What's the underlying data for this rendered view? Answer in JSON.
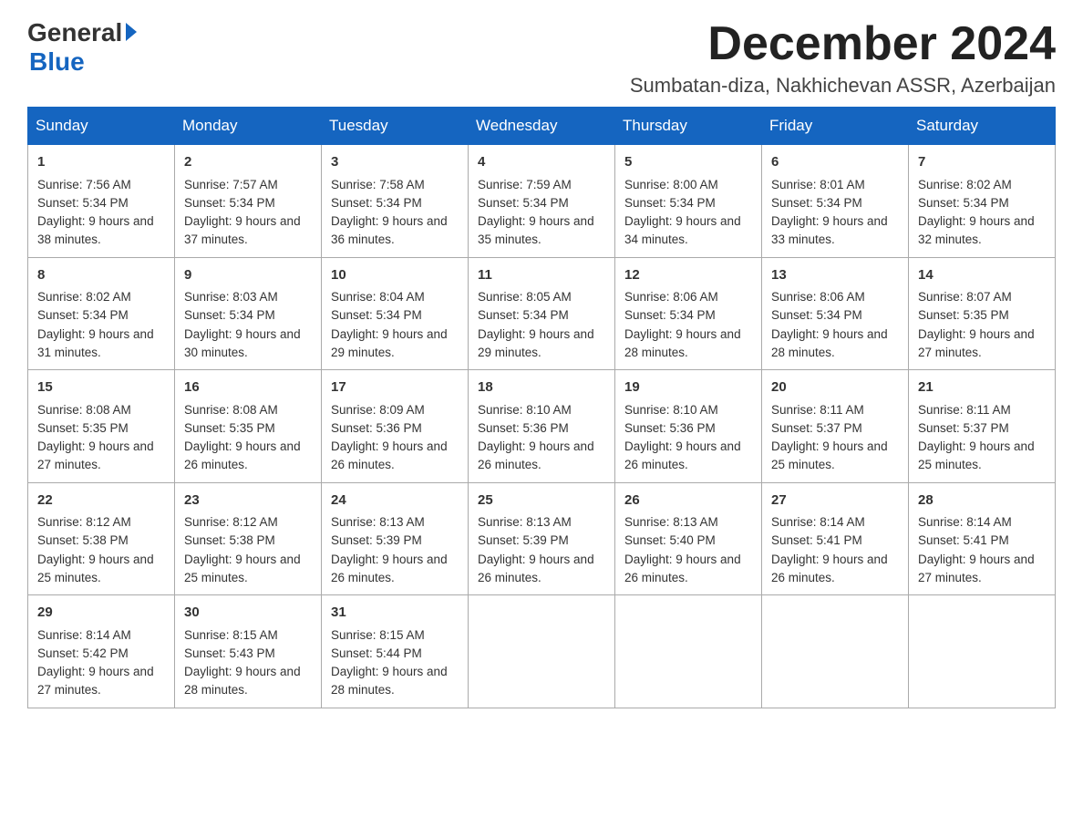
{
  "logo": {
    "general": "General",
    "blue": "Blue"
  },
  "header": {
    "month_title": "December 2024",
    "subtitle": "Sumbatan-diza, Nakhichevan ASSR, Azerbaijan"
  },
  "days_of_week": [
    "Sunday",
    "Monday",
    "Tuesday",
    "Wednesday",
    "Thursday",
    "Friday",
    "Saturday"
  ],
  "weeks": [
    [
      {
        "day": "1",
        "sunrise": "7:56 AM",
        "sunset": "5:34 PM",
        "daylight": "9 hours and 38 minutes."
      },
      {
        "day": "2",
        "sunrise": "7:57 AM",
        "sunset": "5:34 PM",
        "daylight": "9 hours and 37 minutes."
      },
      {
        "day": "3",
        "sunrise": "7:58 AM",
        "sunset": "5:34 PM",
        "daylight": "9 hours and 36 minutes."
      },
      {
        "day": "4",
        "sunrise": "7:59 AM",
        "sunset": "5:34 PM",
        "daylight": "9 hours and 35 minutes."
      },
      {
        "day": "5",
        "sunrise": "8:00 AM",
        "sunset": "5:34 PM",
        "daylight": "9 hours and 34 minutes."
      },
      {
        "day": "6",
        "sunrise": "8:01 AM",
        "sunset": "5:34 PM",
        "daylight": "9 hours and 33 minutes."
      },
      {
        "day": "7",
        "sunrise": "8:02 AM",
        "sunset": "5:34 PM",
        "daylight": "9 hours and 32 minutes."
      }
    ],
    [
      {
        "day": "8",
        "sunrise": "8:02 AM",
        "sunset": "5:34 PM",
        "daylight": "9 hours and 31 minutes."
      },
      {
        "day": "9",
        "sunrise": "8:03 AM",
        "sunset": "5:34 PM",
        "daylight": "9 hours and 30 minutes."
      },
      {
        "day": "10",
        "sunrise": "8:04 AM",
        "sunset": "5:34 PM",
        "daylight": "9 hours and 29 minutes."
      },
      {
        "day": "11",
        "sunrise": "8:05 AM",
        "sunset": "5:34 PM",
        "daylight": "9 hours and 29 minutes."
      },
      {
        "day": "12",
        "sunrise": "8:06 AM",
        "sunset": "5:34 PM",
        "daylight": "9 hours and 28 minutes."
      },
      {
        "day": "13",
        "sunrise": "8:06 AM",
        "sunset": "5:34 PM",
        "daylight": "9 hours and 28 minutes."
      },
      {
        "day": "14",
        "sunrise": "8:07 AM",
        "sunset": "5:35 PM",
        "daylight": "9 hours and 27 minutes."
      }
    ],
    [
      {
        "day": "15",
        "sunrise": "8:08 AM",
        "sunset": "5:35 PM",
        "daylight": "9 hours and 27 minutes."
      },
      {
        "day": "16",
        "sunrise": "8:08 AM",
        "sunset": "5:35 PM",
        "daylight": "9 hours and 26 minutes."
      },
      {
        "day": "17",
        "sunrise": "8:09 AM",
        "sunset": "5:36 PM",
        "daylight": "9 hours and 26 minutes."
      },
      {
        "day": "18",
        "sunrise": "8:10 AM",
        "sunset": "5:36 PM",
        "daylight": "9 hours and 26 minutes."
      },
      {
        "day": "19",
        "sunrise": "8:10 AM",
        "sunset": "5:36 PM",
        "daylight": "9 hours and 26 minutes."
      },
      {
        "day": "20",
        "sunrise": "8:11 AM",
        "sunset": "5:37 PM",
        "daylight": "9 hours and 25 minutes."
      },
      {
        "day": "21",
        "sunrise": "8:11 AM",
        "sunset": "5:37 PM",
        "daylight": "9 hours and 25 minutes."
      }
    ],
    [
      {
        "day": "22",
        "sunrise": "8:12 AM",
        "sunset": "5:38 PM",
        "daylight": "9 hours and 25 minutes."
      },
      {
        "day": "23",
        "sunrise": "8:12 AM",
        "sunset": "5:38 PM",
        "daylight": "9 hours and 25 minutes."
      },
      {
        "day": "24",
        "sunrise": "8:13 AM",
        "sunset": "5:39 PM",
        "daylight": "9 hours and 26 minutes."
      },
      {
        "day": "25",
        "sunrise": "8:13 AM",
        "sunset": "5:39 PM",
        "daylight": "9 hours and 26 minutes."
      },
      {
        "day": "26",
        "sunrise": "8:13 AM",
        "sunset": "5:40 PM",
        "daylight": "9 hours and 26 minutes."
      },
      {
        "day": "27",
        "sunrise": "8:14 AM",
        "sunset": "5:41 PM",
        "daylight": "9 hours and 26 minutes."
      },
      {
        "day": "28",
        "sunrise": "8:14 AM",
        "sunset": "5:41 PM",
        "daylight": "9 hours and 27 minutes."
      }
    ],
    [
      {
        "day": "29",
        "sunrise": "8:14 AM",
        "sunset": "5:42 PM",
        "daylight": "9 hours and 27 minutes."
      },
      {
        "day": "30",
        "sunrise": "8:15 AM",
        "sunset": "5:43 PM",
        "daylight": "9 hours and 28 minutes."
      },
      {
        "day": "31",
        "sunrise": "8:15 AM",
        "sunset": "5:44 PM",
        "daylight": "9 hours and 28 minutes."
      },
      null,
      null,
      null,
      null
    ]
  ],
  "labels": {
    "sunrise": "Sunrise: ",
    "sunset": "Sunset: ",
    "daylight": "Daylight: "
  }
}
